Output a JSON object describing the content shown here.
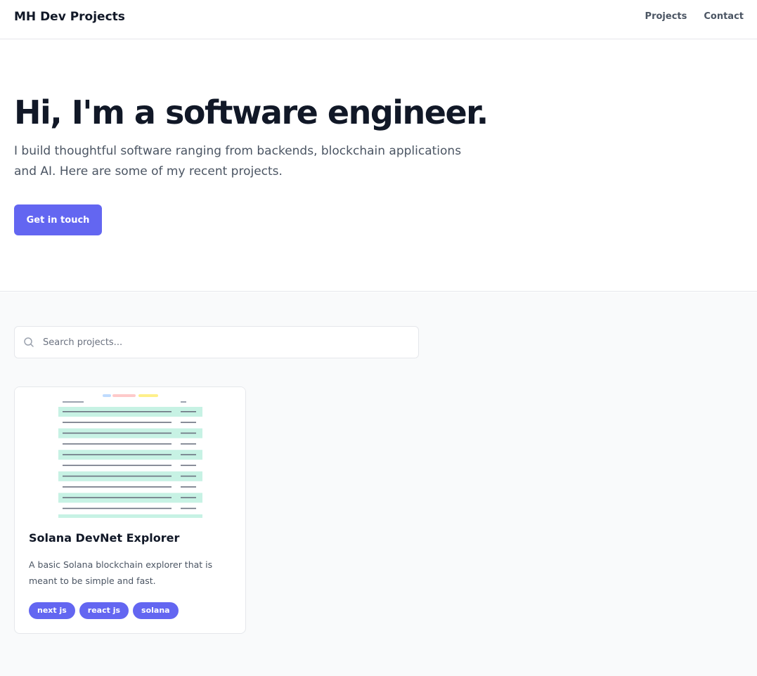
{
  "nav": {
    "brand": "MH Dev Projects",
    "links": [
      {
        "label": "Projects"
      },
      {
        "label": "Contact"
      }
    ]
  },
  "hero": {
    "title": "Hi, I'm a software engineer.",
    "subtitle": "I build thoughtful software ranging from backends, blockchain applications and AI. Here are some of my recent projects.",
    "cta_label": "Get in touch"
  },
  "search": {
    "placeholder": "Search projects...",
    "value": "",
    "icon": "search-icon"
  },
  "projects": [
    {
      "title": "Solana DevNet Explorer",
      "description": "A basic Solana blockchain explorer that is meant to be simple and fast.",
      "tags": [
        "next js",
        "react js",
        "solana"
      ]
    }
  ],
  "colors": {
    "accent": "#6366f1",
    "text_primary": "#111827",
    "text_secondary": "#4b5563",
    "section_bg": "#f9fafb",
    "border": "#e5e7eb"
  }
}
